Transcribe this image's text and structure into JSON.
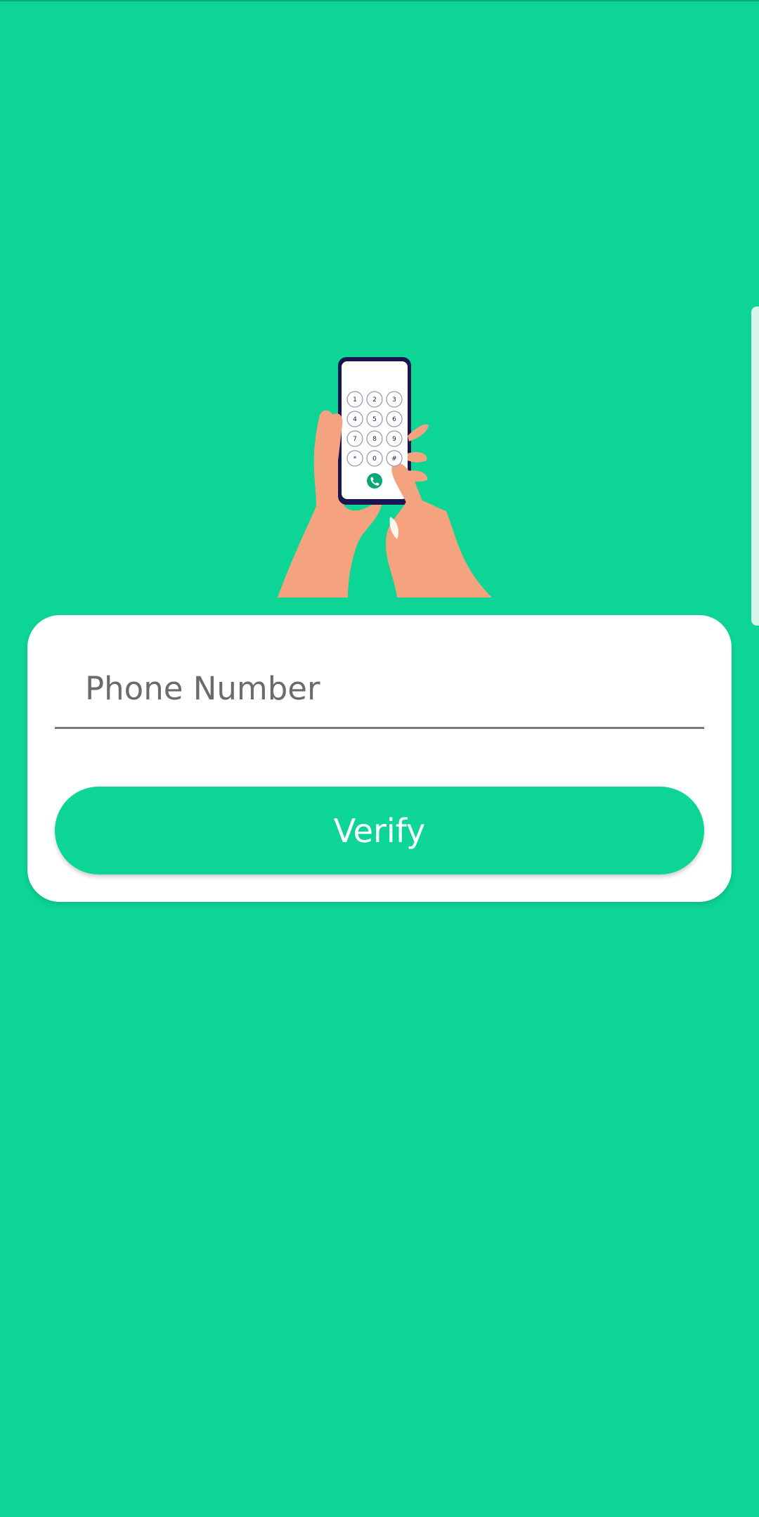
{
  "colors": {
    "background": "#0dd595",
    "card": "#ffffff",
    "accent": "#0dd595",
    "skin": "#f5a37f",
    "phone_frame": "#1a1550"
  },
  "illustration": {
    "icon": "phone-dialpad-illustration",
    "keypad": [
      "1",
      "2",
      "3",
      "4",
      "5",
      "6",
      "7",
      "8",
      "9",
      "*",
      "0",
      "#"
    ]
  },
  "form": {
    "phone_placeholder": "Phone Number",
    "phone_value": "",
    "verify_label": "Verify"
  }
}
